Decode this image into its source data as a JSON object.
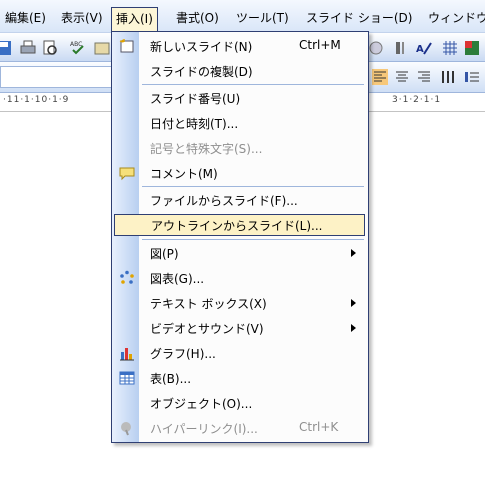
{
  "menubar": {
    "items": [
      "編集(E)",
      "表示(V)",
      "挿入(I)",
      "書式(O)",
      "ツール(T)",
      "スライド ショー(D)",
      "ウィンドウ"
    ]
  },
  "ruler": {
    "left_text": "·11·1·10·1·9",
    "right_text": "3·1·2·1·1"
  },
  "insert_menu": {
    "items": [
      {
        "label": "新しいスライド(N)",
        "shortcut": "Ctrl+M",
        "icon": "new-slide-icon"
      },
      {
        "label": "スライドの複製(D)"
      },
      {
        "label": "スライド番号(U)"
      },
      {
        "label": "日付と時刻(T)..."
      },
      {
        "label": "記号と特殊文字(S)...",
        "disabled": true
      },
      {
        "label": "コメント(M)",
        "icon": "comment-icon"
      },
      {
        "label": "ファイルからスライド(F)..."
      },
      {
        "label": "アウトラインからスライド(L)...",
        "highlighted": true
      },
      {
        "label": "図(P)",
        "submenu": true
      },
      {
        "label": "図表(G)...",
        "icon": "diagram-icon"
      },
      {
        "label": "テキスト ボックス(X)",
        "submenu": true
      },
      {
        "label": "ビデオとサウンド(V)",
        "submenu": true
      },
      {
        "label": "グラフ(H)...",
        "icon": "chart-icon"
      },
      {
        "label": "表(B)...",
        "icon": "table-icon"
      },
      {
        "label": "オブジェクト(O)..."
      },
      {
        "label": "ハイパーリンク(I)...",
        "shortcut": "Ctrl+K",
        "disabled": true,
        "icon": "hyperlink-icon"
      }
    ]
  },
  "colors": {
    "highlight": "#fdf2c6",
    "menu_border": "#2f3f73",
    "gutter": "#b8cff0"
  }
}
